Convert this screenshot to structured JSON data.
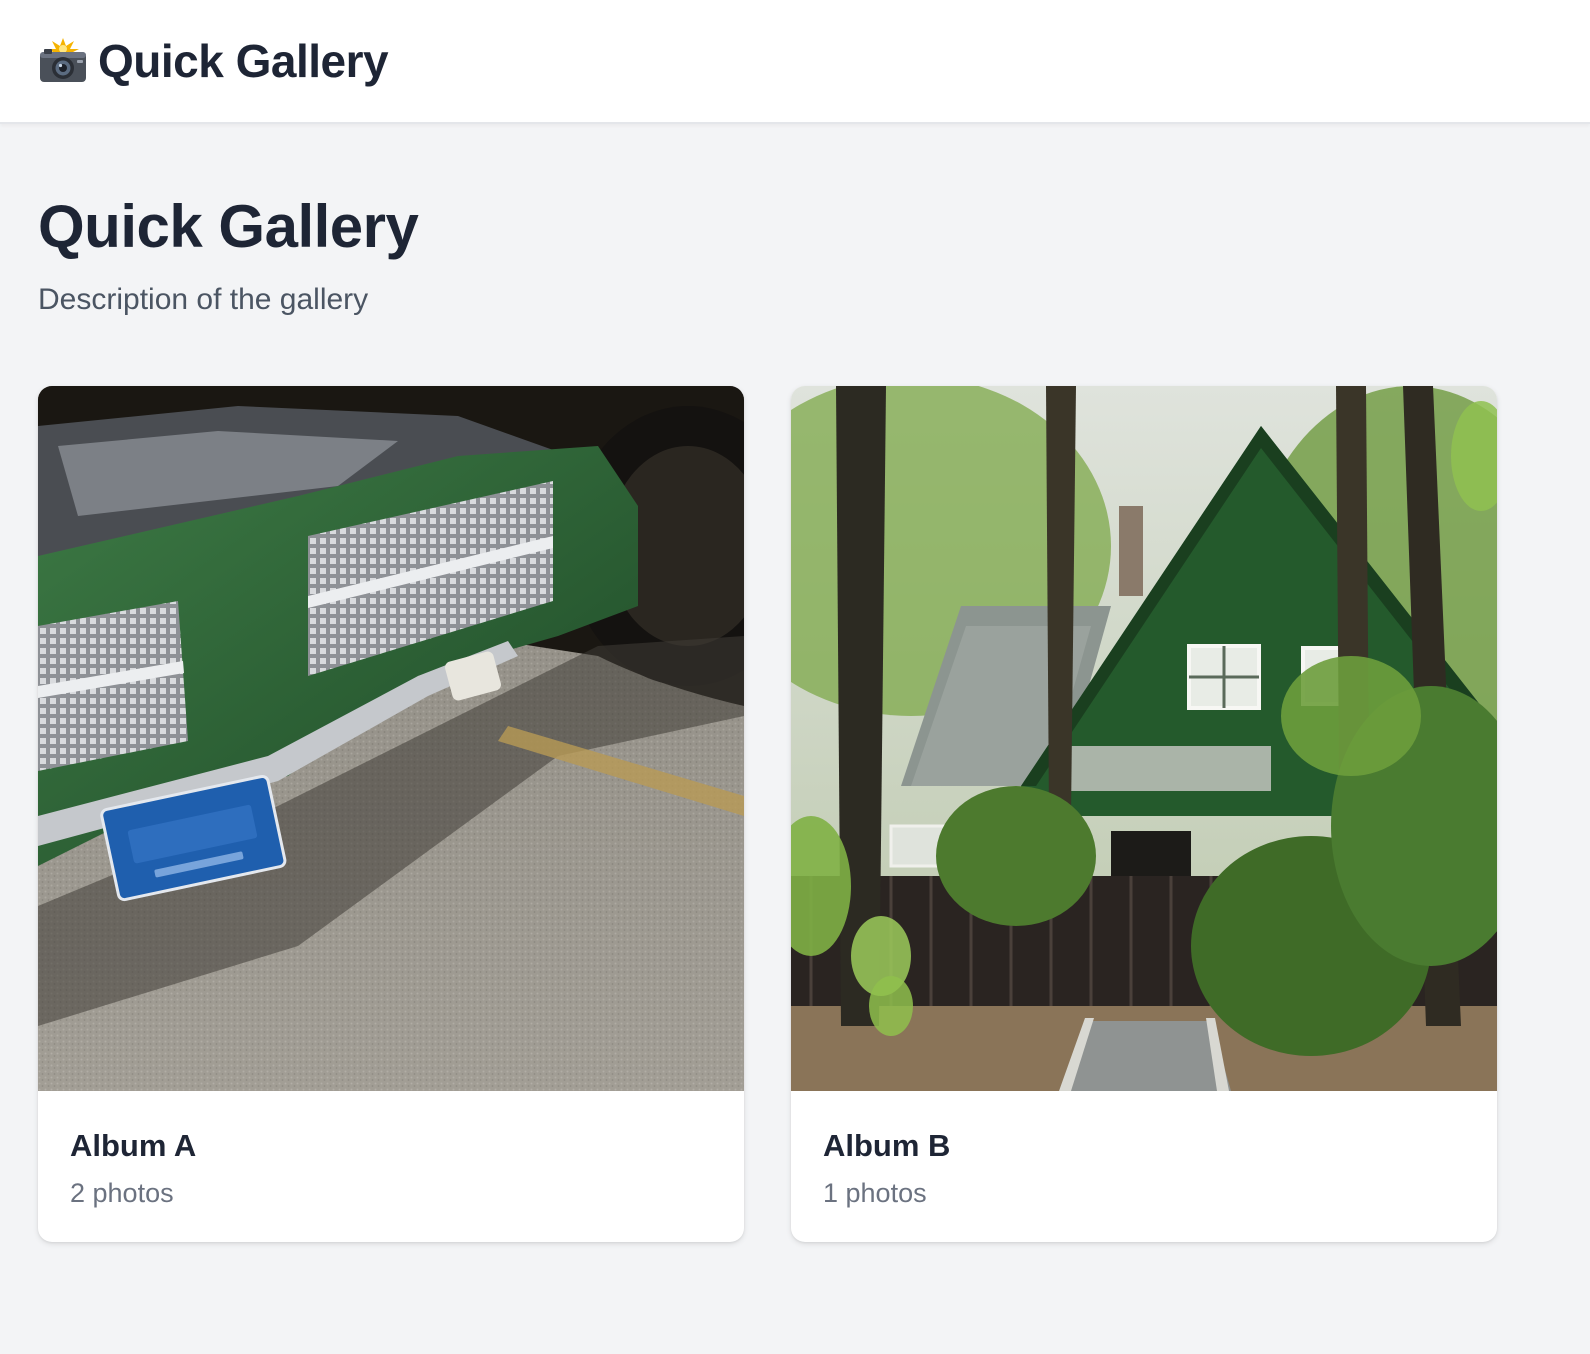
{
  "header": {
    "brand_icon": "camera-flash-icon",
    "brand_text": "Quick Gallery"
  },
  "main": {
    "title": "Quick Gallery",
    "description": "Description of the gallery"
  },
  "albums": [
    {
      "title": "Album A",
      "count": "2 photos",
      "thumbnail": "green-classic-car-front-photo"
    },
    {
      "title": "Album B",
      "count": "1 photos",
      "thumbnail": "green-house-in-forest-photo"
    }
  ],
  "colors": {
    "background": "#f3f4f6",
    "header_bg": "#ffffff",
    "text_primary": "#1e2535",
    "text_secondary": "#4b5563",
    "text_muted": "#6b7280"
  }
}
